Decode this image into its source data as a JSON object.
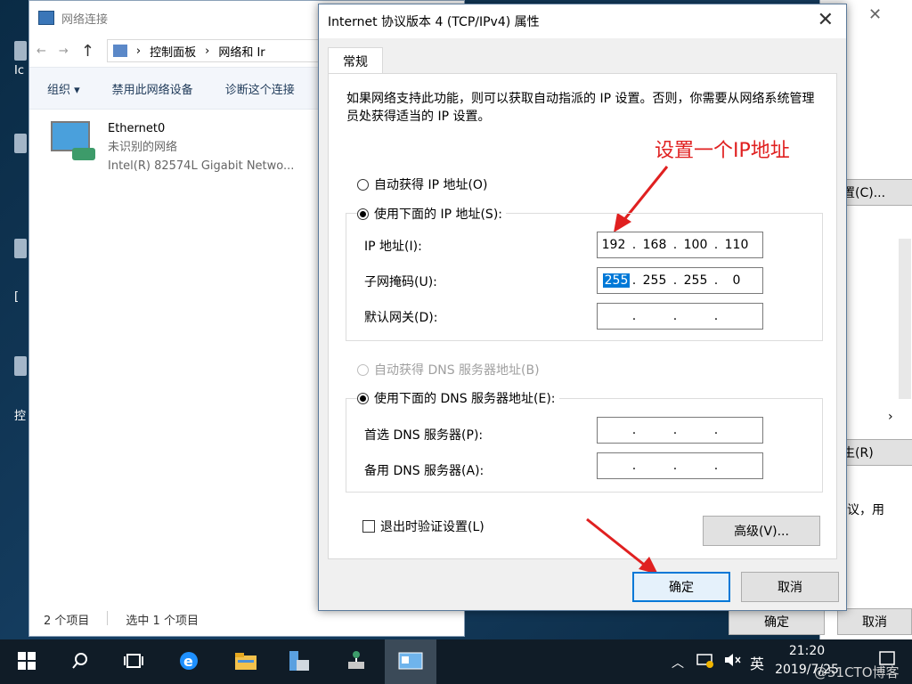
{
  "network_window": {
    "title": "网络连接",
    "breadcrumb": [
      "控制面板",
      "网络和 Ir"
    ],
    "commands": [
      "组织 ▾",
      "禁用此网络设备",
      "诊断这个连接"
    ],
    "adapter": {
      "name": "Ethernet0",
      "status": "未识别的网络",
      "device": "Intel(R) 82574L Gigabit Netwo..."
    },
    "status_bar": {
      "count": "2 个项目",
      "selected": "选中 1 个项目"
    }
  },
  "desktop": {
    "labels": [
      "Ic",
      "[",
      "控"
    ]
  },
  "right_window": {
    "btn1": "置(C)...",
    "btn2": "生(R)",
    "text": "议，用"
  },
  "background_dialog": {
    "ok": "确定",
    "cancel": "取消"
  },
  "dialog": {
    "title": "Internet 协议版本 4 (TCP/IPv4) 属性",
    "tab": "常规",
    "description": "如果网络支持此功能，则可以获取自动指派的 IP 设置。否则，你需要从网络系统管理员处获得适当的 IP 设置。",
    "annotation": "设置一个IP地址",
    "auto_ip": "自动获得 IP 地址(O)",
    "manual_ip": "使用下面的 IP 地址(S):",
    "ip_label": "IP 地址(I):",
    "ip": [
      "192",
      "168",
      "100",
      "110"
    ],
    "mask_label": "子网掩码(U):",
    "mask": [
      "255",
      "255",
      "255",
      "0"
    ],
    "gateway_label": "默认网关(D):",
    "auto_dns": "自动获得 DNS 服务器地址(B)",
    "manual_dns": "使用下面的 DNS 服务器地址(E):",
    "dns1_label": "首选 DNS 服务器(P):",
    "dns2_label": "备用 DNS 服务器(A):",
    "validate": "退出时验证设置(L)",
    "advanced": "高级(V)...",
    "ok": "确定",
    "cancel": "取消"
  },
  "taskbar": {
    "ime": "英",
    "time": "21:20",
    "date": "2019/7/25",
    "watermark": "@51CTO博客"
  },
  "colors": {
    "accent": "#0078d7",
    "annotation": "#e02020",
    "taskbar": "#101c27"
  }
}
